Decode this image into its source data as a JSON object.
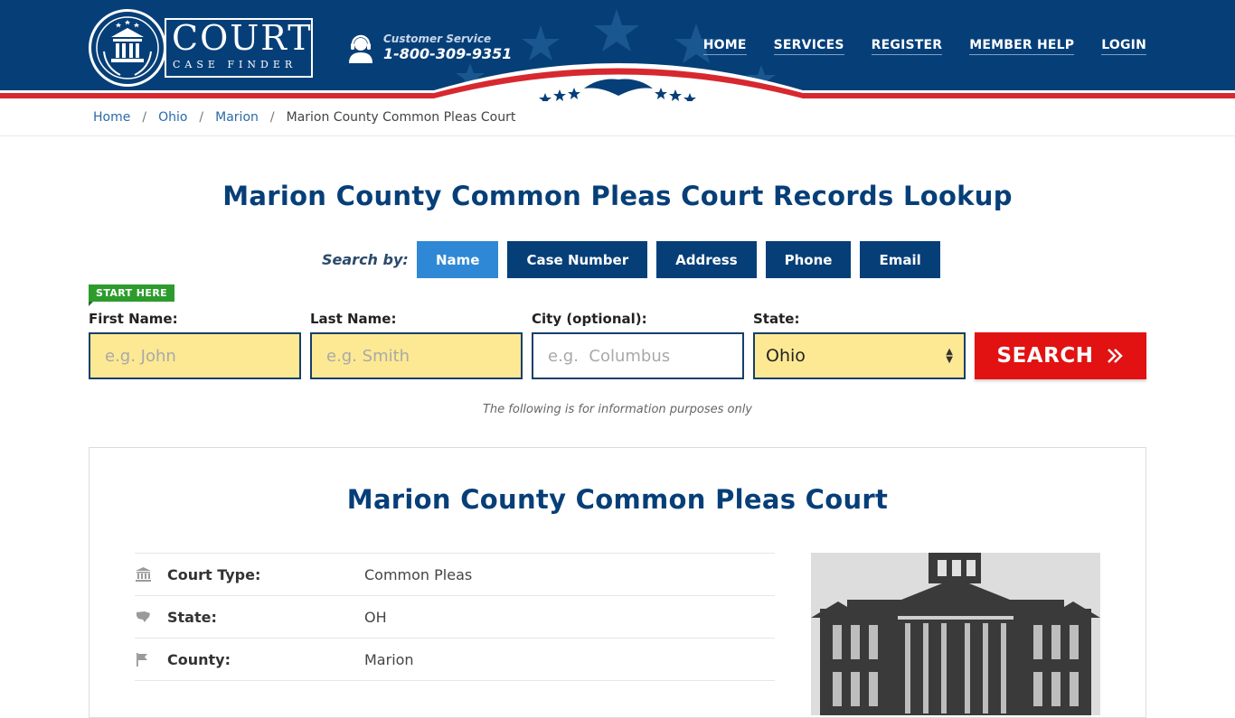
{
  "brand": {
    "name_top": "COURT",
    "name_bottom": "CASE FINDER"
  },
  "customer_service": {
    "label": "Customer Service",
    "phone": "1-800-309-9351"
  },
  "nav": {
    "items": [
      {
        "label": "HOME"
      },
      {
        "label": "SERVICES"
      },
      {
        "label": "REGISTER"
      },
      {
        "label": "MEMBER HELP"
      },
      {
        "label": "LOGIN"
      }
    ]
  },
  "breadcrumb": {
    "items": [
      "Home",
      "Ohio",
      "Marion"
    ],
    "current": "Marion County Common Pleas Court"
  },
  "page_title": "Marion County Common Pleas Court Records Lookup",
  "search": {
    "search_by_label": "Search by:",
    "tabs": [
      {
        "label": "Name",
        "active": true
      },
      {
        "label": "Case Number",
        "active": false
      },
      {
        "label": "Address",
        "active": false
      },
      {
        "label": "Phone",
        "active": false
      },
      {
        "label": "Email",
        "active": false
      }
    ],
    "start_here": "START HERE",
    "first_name": {
      "label": "First Name:",
      "placeholder": "e.g. John"
    },
    "last_name": {
      "label": "Last Name:",
      "placeholder": "e.g. Smith"
    },
    "city": {
      "label": "City (optional):",
      "placeholder": "e.g.  Columbus"
    },
    "state": {
      "label": "State:",
      "value": "Ohio"
    },
    "button_label": "SEARCH",
    "button_icon": "double-chevron-right-icon",
    "note": "The following is for information purposes only"
  },
  "court": {
    "title": "Marion County Common Pleas Court",
    "details": [
      {
        "icon": "courthouse-icon",
        "label": "Court Type:",
        "value": "Common Pleas"
      },
      {
        "icon": "us-map-icon",
        "label": "State:",
        "value": "OH"
      },
      {
        "icon": "flag-icon",
        "label": "County:",
        "value": "Marion"
      }
    ]
  },
  "colors": {
    "header_blue": "#063f78",
    "accent_red": "#e21212",
    "tab_active": "#2f88d6",
    "field_yellow": "#fde993",
    "start_green": "#2d9c2d"
  }
}
